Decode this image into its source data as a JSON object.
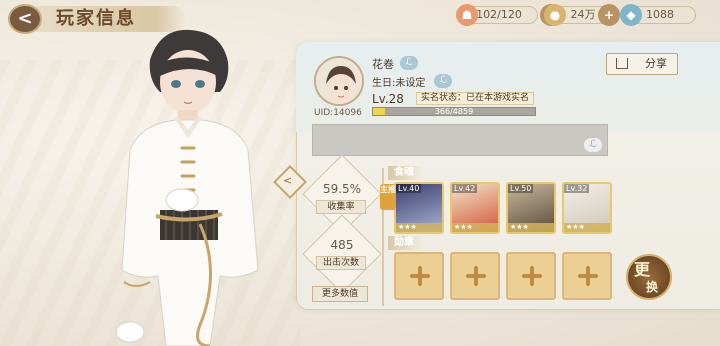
{
  "header": {
    "back": "<",
    "title": "玩家信息"
  },
  "resources": {
    "stamina": "102/120",
    "coins": "24万",
    "gems": "1088",
    "plus": "+"
  },
  "profile": {
    "name": "花卷",
    "birthday": "生日:未设定",
    "uid": "UID:14096",
    "level": "Lv.28",
    "realname_status": "实名状态：已在本游戏实名",
    "exp_text": "366/4859",
    "exp_fraction": 0.075,
    "edit_glyph": "ℒ"
  },
  "share": {
    "label": "分享"
  },
  "stats": {
    "collection_rate": "59.5%",
    "collection_label": "收集率",
    "sortie_count": "485",
    "sortie_label": "出击次数"
  },
  "more_button": "更多数值",
  "sections": {
    "soul": "食魂",
    "medal": "勋章"
  },
  "leader_badge": "主推",
  "cards": [
    {
      "level": "Lv.40",
      "stars": "★★★"
    },
    {
      "level": "Lv.42",
      "stars": "★★★"
    },
    {
      "level": "Lv.50",
      "stars": "★★★"
    },
    {
      "level": "Lv.32",
      "stars": "★★★"
    }
  ],
  "change_button": {
    "line1": "更",
    "line2": "换"
  },
  "colors": {
    "accent": "#c28a3d",
    "panel": "#efece3",
    "exp_fill": "#f0d54a"
  }
}
